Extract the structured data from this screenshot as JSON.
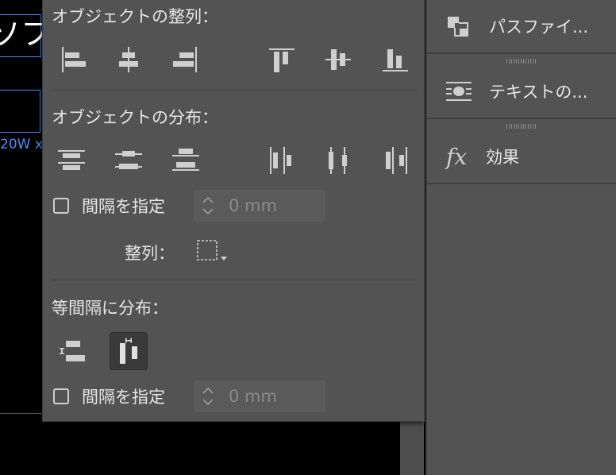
{
  "canvas": {
    "doc_text": "ソフ",
    "measure_label": "20W x"
  },
  "align_panel": {
    "align_objects_title": "オブジェクトの整列：",
    "align_buttons": [
      {
        "name": "align-left-edges",
        "icon": "align-left-icon"
      },
      {
        "name": "align-horizontal-centers",
        "icon": "align-hcenter-icon"
      },
      {
        "name": "align-right-edges",
        "icon": "align-right-icon"
      },
      {
        "name": "align-top-edges",
        "icon": "align-top-icon"
      },
      {
        "name": "align-vertical-centers",
        "icon": "align-vcenter-icon"
      },
      {
        "name": "align-bottom-edges",
        "icon": "align-bottom-icon"
      }
    ],
    "distribute_objects_title": "オブジェクトの分布：",
    "distribute_buttons": [
      {
        "name": "distribute-top-edges",
        "icon": "dist-top-icon"
      },
      {
        "name": "distribute-vertical-centers",
        "icon": "dist-vcenter-icon"
      },
      {
        "name": "distribute-bottom-edges",
        "icon": "dist-bottom-icon"
      },
      {
        "name": "distribute-left-edges",
        "icon": "dist-left-icon"
      },
      {
        "name": "distribute-horizontal-centers",
        "icon": "dist-hcenter-icon"
      },
      {
        "name": "distribute-right-edges",
        "icon": "dist-right-icon"
      }
    ],
    "use_spacing_label_1": "間隔を指定",
    "spacing_value_1": "0 mm",
    "align_to_label": "整列：",
    "distribute_spacing_title": "等間隔に分布：",
    "use_spacing_label_2": "間隔を指定",
    "spacing_value_2": "0 mm",
    "selected_spacing_button": "horizontal"
  },
  "right_panel": {
    "items": [
      {
        "label": "パスファイ...",
        "icon": "pathfinder-icon"
      },
      {
        "label": "テキストの...",
        "icon": "text-wrap-icon"
      },
      {
        "label": "効果",
        "icon": "fx-icon"
      }
    ]
  },
  "colors": {
    "panel_bg": "#535353",
    "text": "#e6e6e6",
    "icon": "#cfcfcf",
    "selection_blue": "#4a8cff"
  }
}
